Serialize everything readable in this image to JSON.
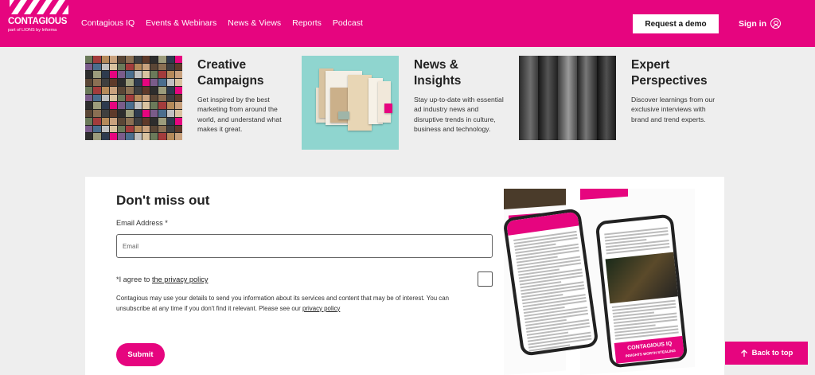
{
  "header": {
    "logo_text": "CONTAGIOUS",
    "logo_sub": "part of LIONS by Informa",
    "nav": [
      "Contagious IQ",
      "Events & Webinars",
      "News & Views",
      "Reports",
      "Podcast"
    ],
    "demo_label": "Request a demo",
    "signin_label": "Sign in",
    "user_icon": "user-circle-icon"
  },
  "cards": [
    {
      "title": "Creative Campaigns",
      "desc": "Get inspired by the best marketing from around the world, and understand what makes it great."
    },
    {
      "title": "News & Insights",
      "desc": "Stay up-to-date with essential ad industry news and disruptive trends in culture, business and technology."
    },
    {
      "title": "Expert Perspectives",
      "desc": "Discover learnings from our exclusive interviews with brand and trend experts."
    }
  ],
  "form": {
    "title": "Don't miss out",
    "email_label": "Email Address *",
    "email_placeholder": "Email",
    "email_value": "",
    "agree_prefix": "*I agree to ",
    "agree_link": "the privacy policy",
    "disclaimer_text": "Contagious may use your details to send you information about its services and content that may be of interest. You can unsubscribe at any time if you don't find it relevant. Please see our ",
    "disclaimer_link": "privacy policy",
    "submit_label": "Submit"
  },
  "phone_promo": {
    "banner_text": "CONTAGIOUS IQ",
    "banner_sub": "INSIGHTS WORTH STEALING"
  },
  "back_to_top": {
    "label": "Back to top",
    "icon": "arrow-up-icon"
  },
  "colors": {
    "brand": "#e6057f",
    "background": "#eeeeee",
    "panel": "#ffffff"
  }
}
